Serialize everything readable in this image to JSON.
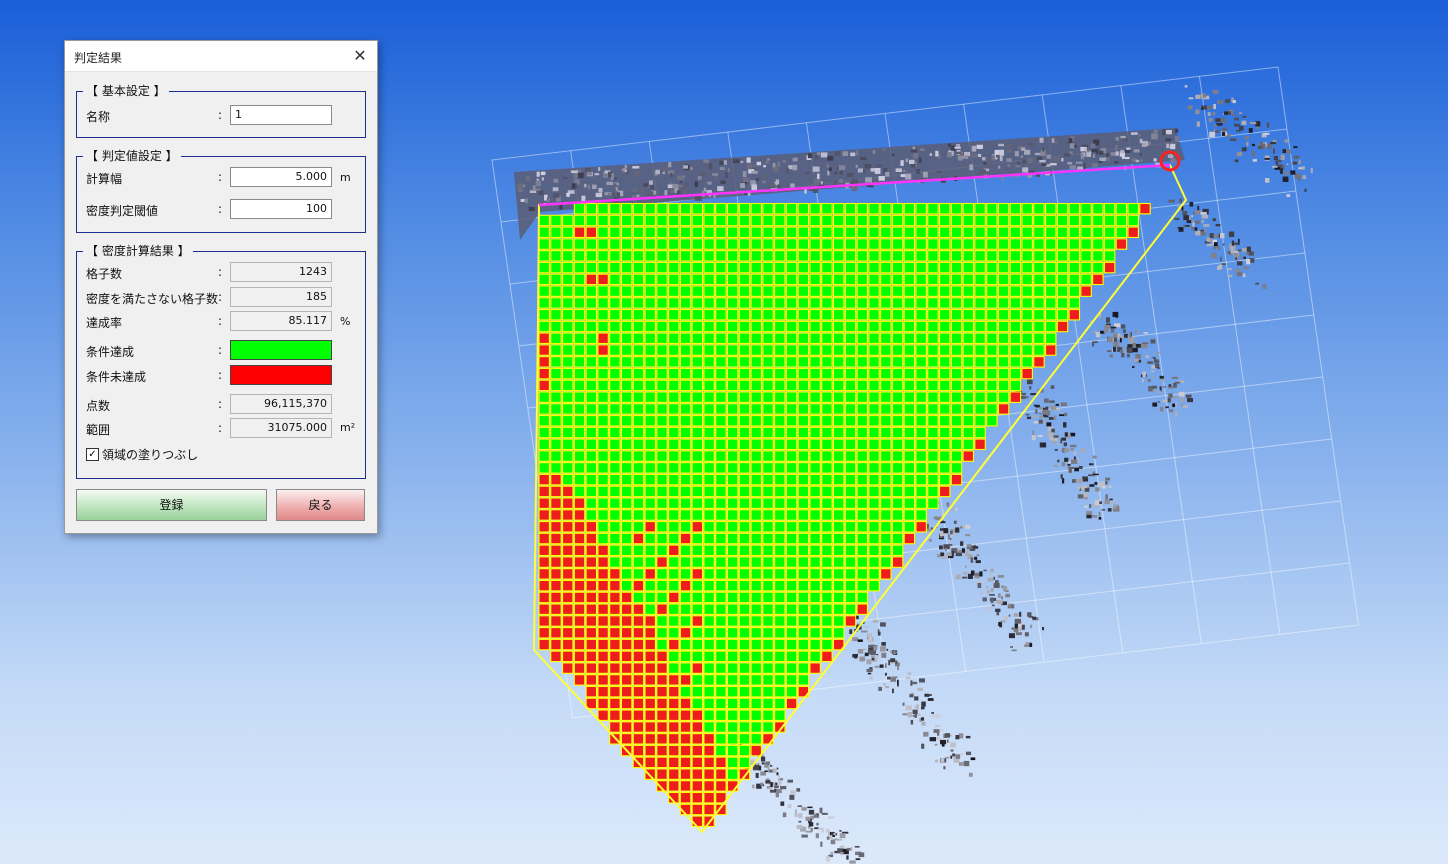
{
  "dialog": {
    "title": "判定結果",
    "close_glyph": "✕",
    "basic": {
      "group_title": "【 基本設定 】",
      "name_label": "名称",
      "name_value": "1"
    },
    "threshold": {
      "group_title": "【 判定値設定 】",
      "calc_width_label": "計算幅",
      "calc_width_value": "5.000",
      "calc_width_unit": "m",
      "density_threshold_label": "密度判定閾値",
      "density_threshold_value": "100"
    },
    "results": {
      "group_title": "【 密度計算結果 】",
      "grid_count_label": "格子数",
      "grid_count_value": "1243",
      "unmet_count_label": "密度を満たさない格子数",
      "unmet_count_value": "185",
      "rate_label": "達成率",
      "rate_value": "85.117",
      "rate_unit": "%",
      "met_label": "条件達成",
      "met_color": "#00ff00",
      "unmet_label": "条件未達成",
      "unmet_color": "#ff0000",
      "points_label": "点数",
      "points_value": "96,115,370",
      "area_label": "範囲",
      "area_value": "31075.000",
      "area_unit": "m²",
      "fill_checkbox_label": "領域の塗りつぶし",
      "fill_checked": true,
      "check_glyph": "✓"
    },
    "register_button": "登録",
    "back_button": "戻る"
  },
  "colors": {
    "cell_ok": "#00ff00",
    "cell_ng": "#ee1c1c",
    "cell_border": "#ffff00",
    "boundary": "#ffff33",
    "top_edge": "#ff33ff",
    "marker": "#ff2020"
  }
}
